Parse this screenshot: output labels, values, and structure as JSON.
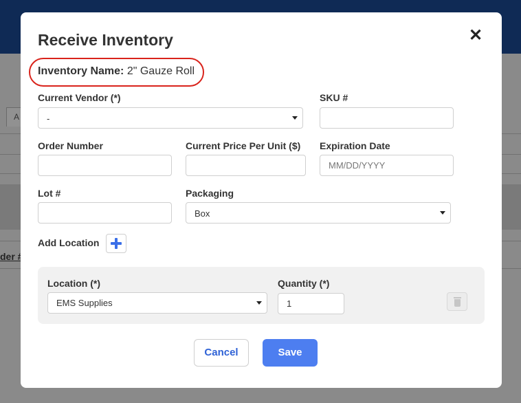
{
  "background": {
    "tab_label": "A",
    "partial_text": "der #"
  },
  "modal": {
    "title": "Receive Inventory",
    "close_glyph": "✕",
    "inventory_name_label": "Inventory Name:",
    "inventory_name_value": "2\" Gauze Roll",
    "current_vendor": {
      "label": "Current Vendor (*)",
      "value": "-"
    },
    "sku": {
      "label": "SKU #",
      "value": ""
    },
    "order_number": {
      "label": "Order Number",
      "value": ""
    },
    "price_per_unit": {
      "label": "Current Price Per Unit ($)",
      "value": ""
    },
    "expiration_date": {
      "label": "Expiration Date",
      "placeholder": "MM/DD/YYYY",
      "value": ""
    },
    "lot": {
      "label": "Lot #",
      "value": ""
    },
    "packaging": {
      "label": "Packaging",
      "value": "Box"
    },
    "add_location_label": "Add Location",
    "location_row": {
      "location_label": "Location (*)",
      "location_value": "EMS Supplies",
      "quantity_label": "Quantity (*)",
      "quantity_value": "1"
    },
    "cancel_label": "Cancel",
    "save_label": "Save"
  },
  "colors": {
    "header": "#0f2a55",
    "highlight": "#d9231b",
    "accent": "#4d7ef0",
    "link": "#2f62d6"
  },
  "icons": [
    "close-icon",
    "plus-icon",
    "trash-icon",
    "caret-down-icon"
  ]
}
